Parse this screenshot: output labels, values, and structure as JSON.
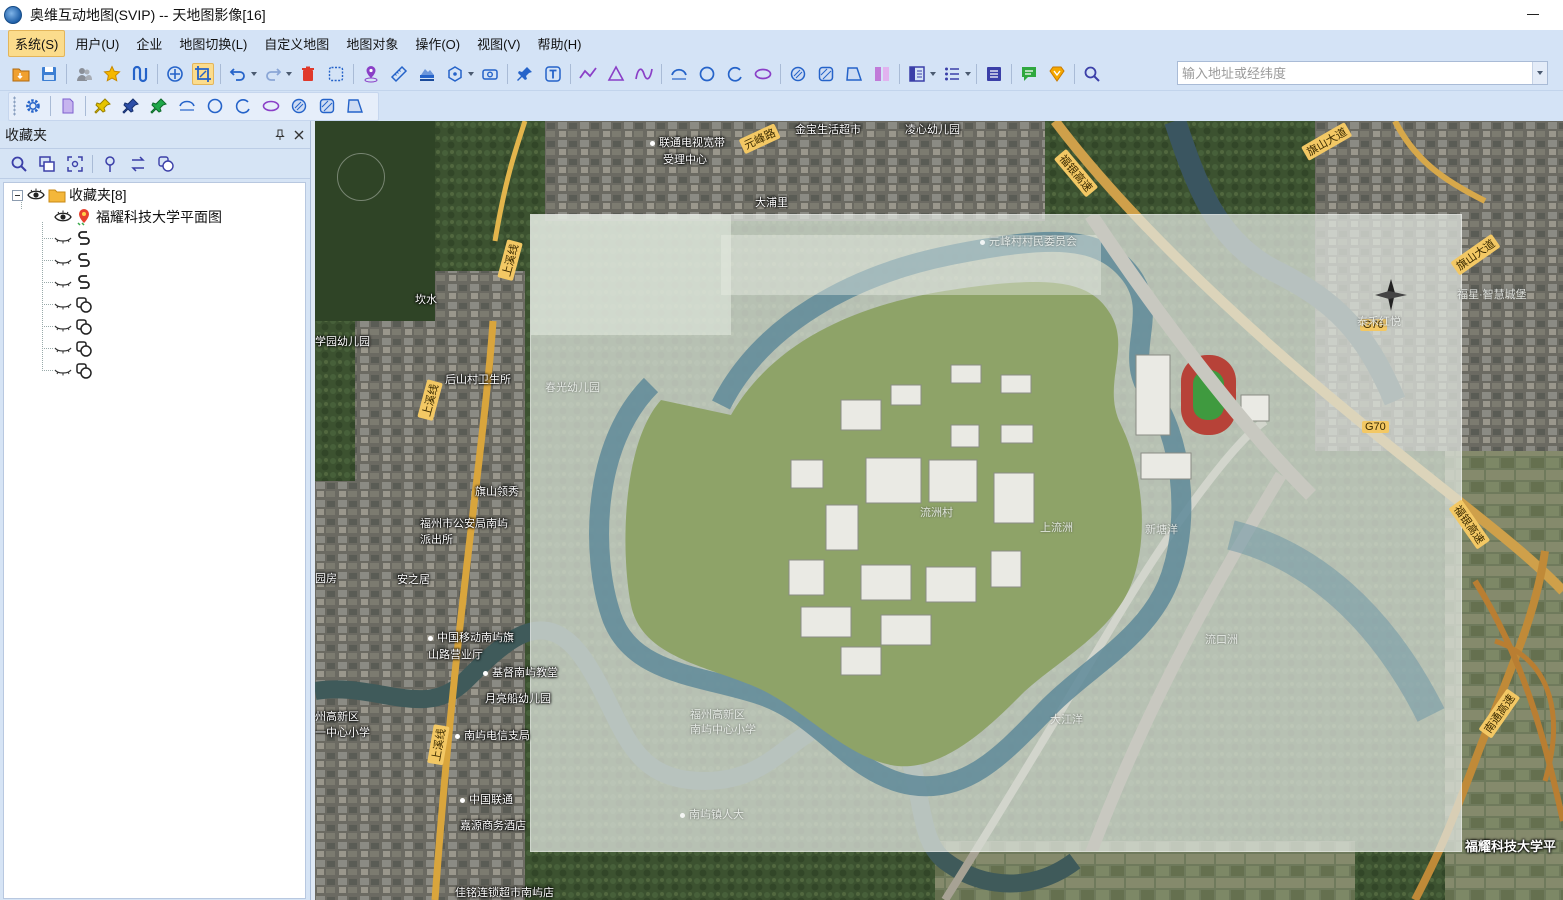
{
  "window": {
    "title": "奥维互动地图(SVIP) -- 天地图影像[16]"
  },
  "menu": {
    "items": [
      "系统(S)",
      "用户(U)",
      "企业",
      "地图切换(L)",
      "自定义地图",
      "地图对象",
      "操作(O)",
      "视图(V)",
      "帮助(H)"
    ],
    "active_index": 0
  },
  "toolbar": {
    "search_placeholder": "输入地址或经纬度",
    "icons_row1": [
      "open-folder-icon",
      "save-icon",
      "users-icon",
      "favorite-star-icon",
      "track-icon",
      "layer-3d-icon",
      "crop-tool-icon",
      "undo-icon",
      "redo-icon",
      "delete-icon",
      "select-rect-icon",
      "place-pin-icon",
      "ruler-icon",
      "elevation-icon",
      "compass-shape-icon",
      "camera-icon",
      "add-pin-icon",
      "text-label-icon",
      "polyline-icon",
      "polygon-icon",
      "curve-icon",
      "arc-icon",
      "circle-icon",
      "circle-arc-icon",
      "ellipse-icon",
      "hatched-circle-icon",
      "hatched-square-icon",
      "hatched-polygon-icon",
      "split-view-icon",
      "panel-layout-icon",
      "bullet-list-icon",
      "table-view-icon",
      "chat-icon",
      "vip-badge-icon",
      "zoom-search-icon"
    ],
    "icons_row2": [
      "gear-icon",
      "new-file-icon",
      "yellow-pin-icon",
      "blue-pin-icon",
      "green-pin-icon",
      "arc-line-icon",
      "circle-icon",
      "arc-icon",
      "ellipse-icon",
      "hatched-circle-icon",
      "hatched-square-icon",
      "hatched-polygon-icon"
    ]
  },
  "favorites_panel": {
    "title": "收藏夹",
    "root_label": "收藏夹[8]",
    "first_item": "福耀科技大学平面图",
    "hidden_items": [
      {
        "type": "track-icon"
      },
      {
        "type": "track-icon"
      },
      {
        "type": "track-icon"
      },
      {
        "type": "polygon-overlap-icon"
      },
      {
        "type": "polygon-overlap-icon"
      },
      {
        "type": "polygon-overlap-icon"
      },
      {
        "type": "polygon-overlap-icon"
      }
    ]
  },
  "map": {
    "labels": [
      {
        "text": "联通电视宽带",
        "poi": true
      },
      {
        "text": "受理中心",
        "poi": false
      },
      {
        "text": "元峰路",
        "poi": false
      },
      {
        "text": "金宝生活超市",
        "poi": false
      },
      {
        "text": "凌心幼儿园",
        "poi": false
      },
      {
        "text": "大浦里",
        "poi": false
      },
      {
        "text": "福银高速",
        "poi": false
      },
      {
        "text": "旗山大道",
        "poi": false
      },
      {
        "text": "元峰村村民委员会",
        "poi": true
      },
      {
        "text": "坎水",
        "poi": false
      },
      {
        "text": "上溪线",
        "poi": false
      },
      {
        "text": "学园幼儿园",
        "poi": false
      },
      {
        "text": "后山村卫生所",
        "poi": false
      },
      {
        "text": "春光幼儿园",
        "poi": false
      },
      {
        "text": "上溪线",
        "poi": false
      },
      {
        "text": "旗山领秀",
        "poi": false
      },
      {
        "text": "福州市公安局南屿",
        "poi": false
      },
      {
        "text": "派出所",
        "poi": false
      },
      {
        "text": "园房",
        "poi": false
      },
      {
        "text": "安之居",
        "poi": false
      },
      {
        "text": "中国移动南屿旗",
        "poi": true
      },
      {
        "text": "山路营业厅",
        "poi": false
      },
      {
        "text": "基督南屿教堂",
        "poi": true
      },
      {
        "text": "月亮船幼儿园",
        "poi": false
      },
      {
        "text": "州高新区",
        "poi": false
      },
      {
        "text": "一中心小学",
        "poi": false
      },
      {
        "text": "南屿电信支局",
        "poi": true
      },
      {
        "text": "上溪线",
        "poi": false
      },
      {
        "text": "中国联通",
        "poi": true
      },
      {
        "text": "嘉源商务酒店",
        "poi": false
      },
      {
        "text": "佳铭连锁超市南屿店",
        "poi": false
      },
      {
        "text": "福州高新区",
        "poi": false
      },
      {
        "text": "南屿中心小学",
        "poi": false
      },
      {
        "text": "南屿镇人大",
        "poi": true
      },
      {
        "text": "流洲村",
        "poi": false
      },
      {
        "text": "上流洲",
        "poi": false
      },
      {
        "text": "新塘洋",
        "poi": false
      },
      {
        "text": "流口洲",
        "poi": false
      },
      {
        "text": "大江洋",
        "poi": false
      },
      {
        "text": "G70",
        "poi": false
      },
      {
        "text": "G70",
        "poi": false
      },
      {
        "text": "福银高速",
        "poi": false
      },
      {
        "text": "南通高速",
        "poi": false
      },
      {
        "text": "旗山大道",
        "poi": false
      },
      {
        "text": "福星·智慧城堡",
        "poi": false
      },
      {
        "text": "泰禾红悦",
        "poi": false
      },
      {
        "text": "福耀科技大学平",
        "poi": false
      }
    ]
  }
}
